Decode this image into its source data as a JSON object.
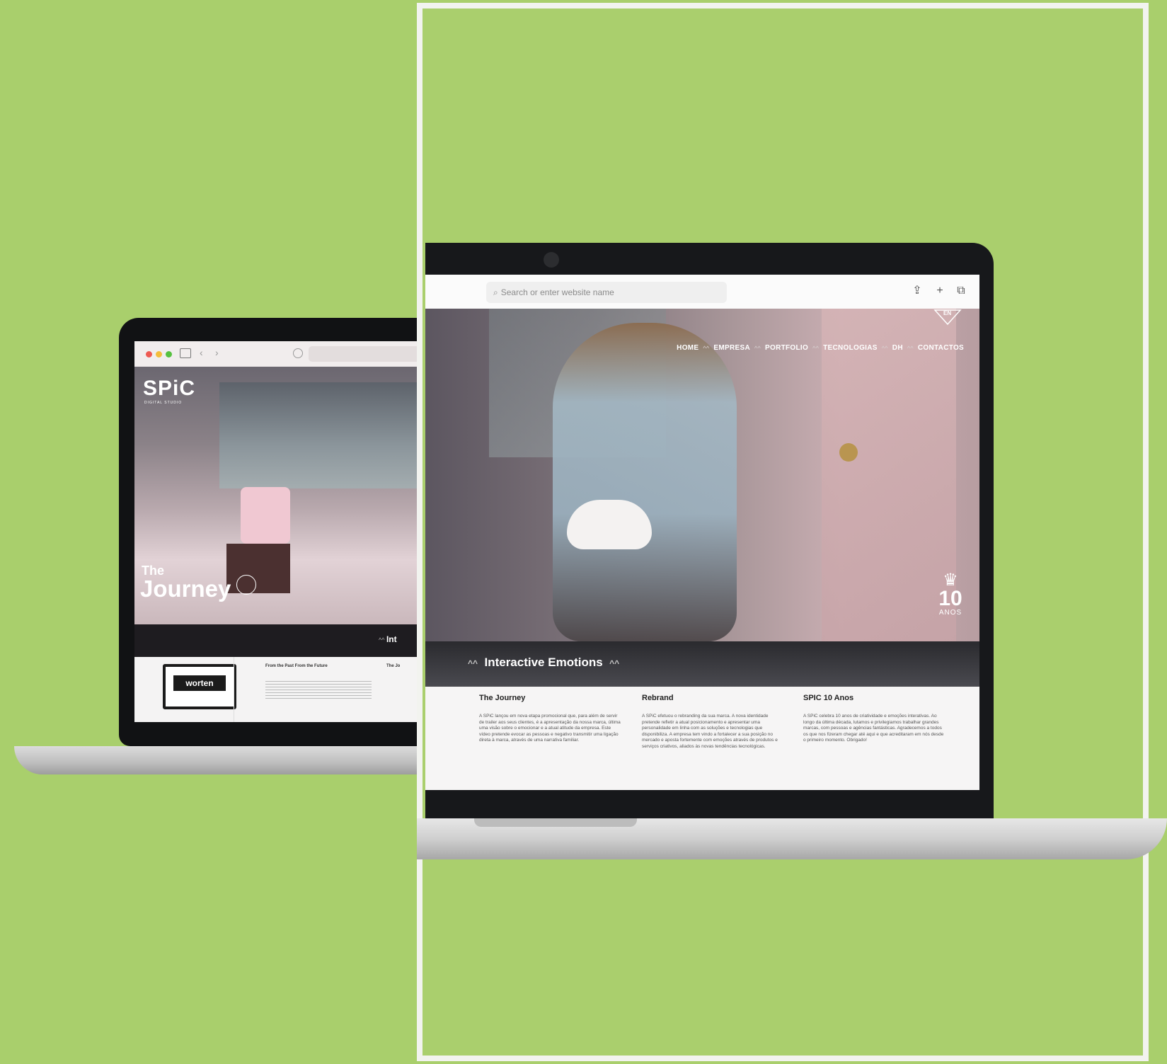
{
  "left_laptop": {
    "brand": "SPiC",
    "brand_sub": "DIGITAL STUDIO",
    "hero_title_small": "The",
    "hero_title_large": "Journey",
    "band_label": "Int",
    "monitor_logo": "worten",
    "card1_title": "From the Past From the Future",
    "card2_title": "The Jo"
  },
  "right_laptop": {
    "search_placeholder": "Search or enter website name",
    "nav": [
      "HOME",
      "EMPRESA",
      "PORTFOLIO",
      "TECNOLOGIAS",
      "DH",
      "CONTACTOS"
    ],
    "lang_badge": "EN",
    "badge_number": "10",
    "badge_text": "ANOS",
    "section_title": "Interactive Emotions",
    "cards": [
      {
        "title": "The Journey",
        "body": "A SPiC lançou em nova etapa promocional que, para além de servir de trailer aos seus clientes, é a apresentação da nossa marca, última uma visão sobre o emocionar e a atual atitude da empresa. Este vídeo pretende evocar as pessoas e negativo transmitir uma ligação direta à marca, através de uma narrativa familiar."
      },
      {
        "title": "Rebrand",
        "body": "A SPiC efetuou o rebranding da sua marca. A nova identidade pretende refletir a atual posicionamento e apresentar uma personalidade em linha com as soluções e tecnologias que disponibiliza. A empresa tem vindo a fortalecer a sua posição no mercado e aposta fortemente com emoções através de produtos e serviços criativos, aliados às novas tendências tecnológicas."
      },
      {
        "title": "SPIC 10 Anos",
        "body": "A SPiC celebra 10 anos de criatividade e emoções interativas. Ao longo da última década, lutamos e privilegiamos trabalhar grandes marcas, com pessoas e agências fantásticas. Agradecemos a todos os que nos fizeram chegar até aqui e que acreditaram em nós desde o primeiro momento. Obrigado!"
      }
    ]
  },
  "colors": {
    "background": "#a9cf6c",
    "frame_border": "#f2f3ef",
    "laptop_body": "#17181b"
  }
}
